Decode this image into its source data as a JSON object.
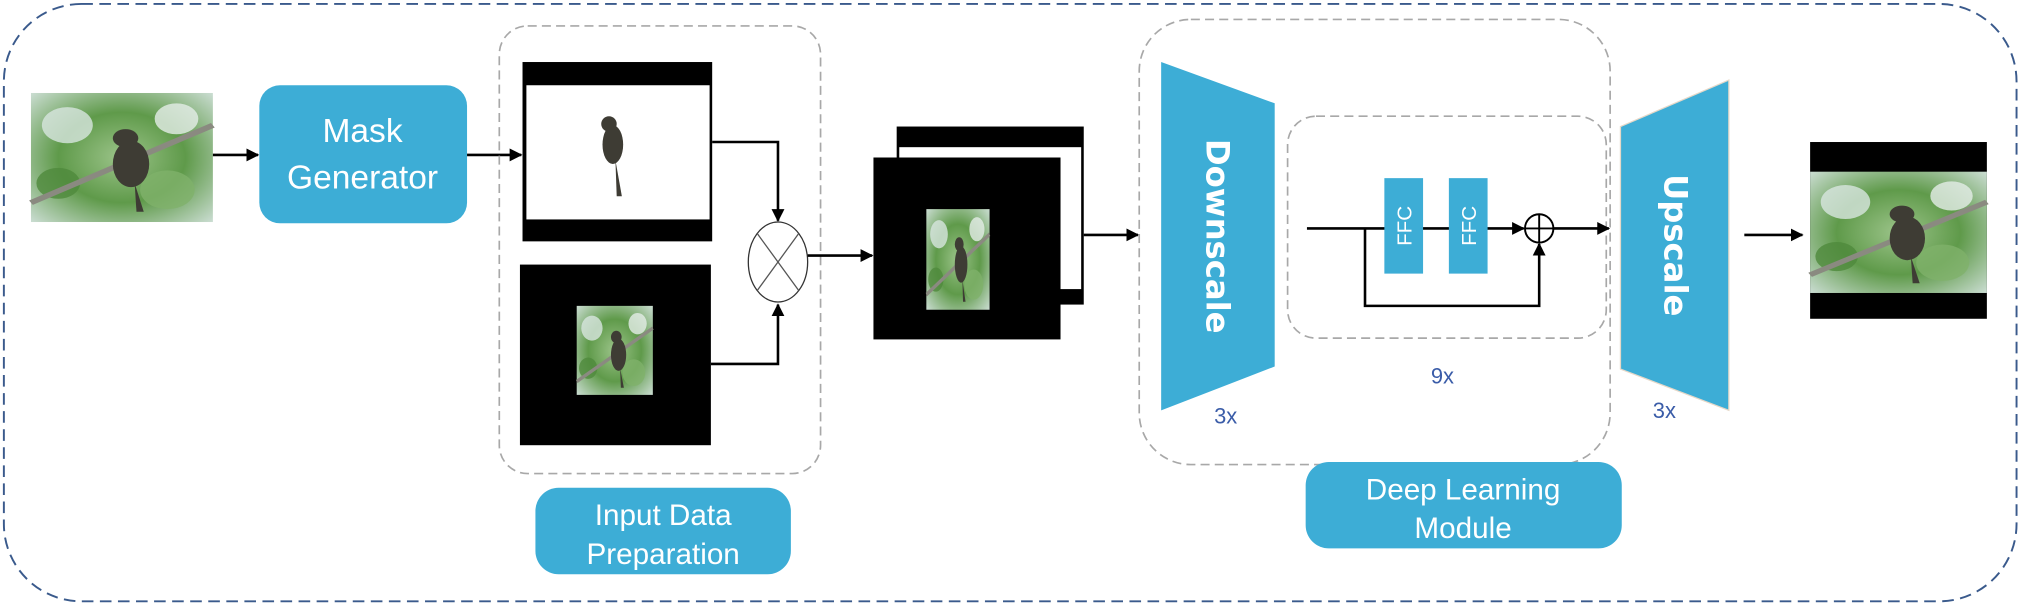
{
  "colors": {
    "module_fill": "#3dadd6",
    "outer_border": "#3a5a8c",
    "group_border": "#a8a8a8",
    "count_text": "#3a5ca8"
  },
  "blocks": {
    "mask_generator": [
      "Mask",
      "Generator"
    ],
    "input_data_preparation": [
      "Input Data",
      "Preparation"
    ],
    "deep_learning_module": [
      "Deep Learning",
      "Module"
    ],
    "downscale": "Downscale",
    "upscale": "Upscale",
    "ffc_1": "FFC",
    "ffc_2": "FFC"
  },
  "counts": {
    "downscale": "3x",
    "ffc_blocks": "9x",
    "upscale": "3x"
  },
  "operators": {
    "combine": "multiply-icon",
    "residual": "add-icon"
  }
}
